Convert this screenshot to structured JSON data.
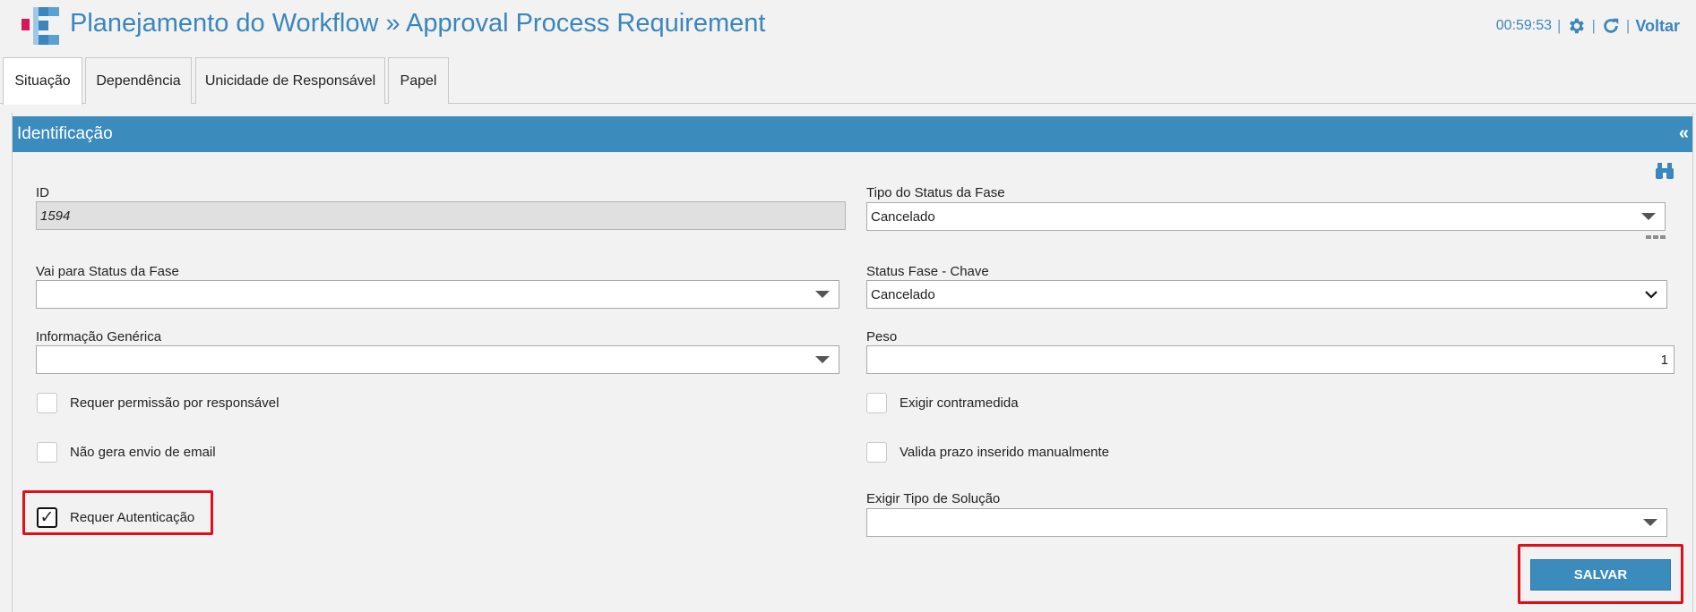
{
  "header": {
    "title": "Planejamento do Workflow » Approval Process Requirement",
    "timer": "00:59:53",
    "separator": "|",
    "back_label": "Voltar",
    "icons": [
      "app-logo-icon",
      "gear-icon",
      "refresh-icon"
    ]
  },
  "tabs": [
    {
      "label": "Situação",
      "active": true
    },
    {
      "label": "Dependência",
      "active": false
    },
    {
      "label": "Unicidade de Responsável",
      "active": false
    },
    {
      "label": "Papel",
      "active": false
    }
  ],
  "panel": {
    "title": "Identificação",
    "collapse_glyph": "«"
  },
  "form": {
    "id": {
      "label": "ID",
      "value": "1594"
    },
    "tipo_status_fase": {
      "label": "Tipo do Status da Fase",
      "value": "Cancelado"
    },
    "vai_para_status": {
      "label": "Vai para Status da Fase",
      "value": ""
    },
    "status_fase_chave": {
      "label": "Status Fase - Chave",
      "value": "Cancelado"
    },
    "informacao_generica": {
      "label": "Informação Genérica",
      "value": ""
    },
    "peso": {
      "label": "Peso",
      "value": "1"
    },
    "checkboxes": {
      "requer_permissao": {
        "label": "Requer permissão por responsável",
        "checked": false
      },
      "exigir_contramedida": {
        "label": "Exigir contramedida",
        "checked": false
      },
      "nao_gera_email": {
        "label": "Não gera envio de email",
        "checked": false
      },
      "valida_prazo": {
        "label": "Valida prazo inserido manualmente",
        "checked": false
      },
      "requer_autenticacao": {
        "label": "Requer Autenticação",
        "checked": true,
        "check_glyph": "✓"
      }
    },
    "exigir_tipo_solucao": {
      "label": "Exigir Tipo de Solução",
      "value": ""
    }
  },
  "actions": {
    "save_label": "SALVAR"
  },
  "colors": {
    "accent": "#3b8bbd",
    "title_blue": "#3a86bd",
    "highlight_red": "#e0101b",
    "logo_pink": "#d6175a"
  }
}
